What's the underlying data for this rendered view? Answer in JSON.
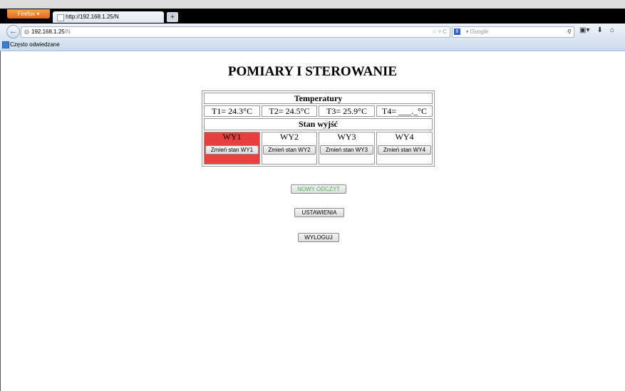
{
  "browser": {
    "firefox_label": "Firefox",
    "tab_title": "http://192.168.1.25/N",
    "newtab_label": "+",
    "back_label": "←",
    "url_host": "192.168.1.25",
    "url_path": "/N",
    "search_engine": "Google",
    "bookmark_label": "Często odwiedzane"
  },
  "page": {
    "title": "POMIARY I STEROWANIE",
    "temperatures_header": "Temperatury",
    "temperatures": [
      "T1= 24.3°C",
      "T2= 24.5°C",
      "T3= 25.9°C",
      "T4= ___._°C"
    ],
    "outputs_header": "Stan wyjść",
    "outputs": [
      {
        "label": "WY1",
        "button": "Zmień stan WY1",
        "active": true
      },
      {
        "label": "WY2",
        "button": "Zmień stan WY2",
        "active": false
      },
      {
        "label": "WY3",
        "button": "Zmień stan WY3",
        "active": false
      },
      {
        "label": "WY4",
        "button": "Zmień stan WY4",
        "active": false
      }
    ],
    "refresh_button": "NOWY ODCZYT",
    "settings_button": "USTAWIENIA",
    "logout_button": "WYLOGUJ"
  },
  "colors": {
    "active_output": "#e8403f",
    "refresh_text": "#4caf50"
  },
  "icons": [
    "firefox-icon",
    "back-arrow-icon",
    "globe-icon",
    "star-icon",
    "reload-icon",
    "google-icon",
    "search-icon",
    "bookmarks-icon",
    "download-icon",
    "home-icon"
  ]
}
